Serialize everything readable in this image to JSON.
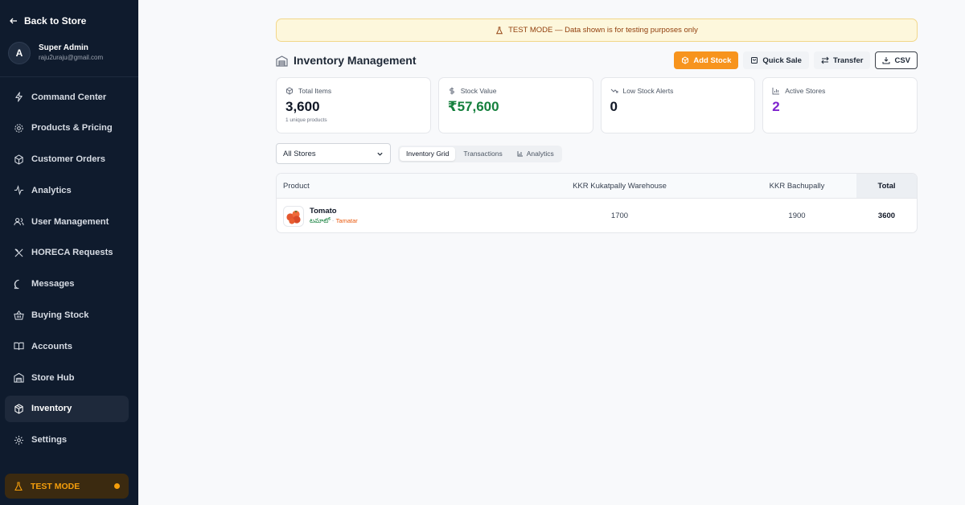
{
  "sidebar": {
    "back_label": "Back to Store",
    "user": {
      "initial": "A",
      "name": "Super Admin",
      "email": "raju2uraju@gmail.com"
    },
    "items": [
      {
        "label": "Command Center",
        "icon": "lightning-icon"
      },
      {
        "label": "Products & Pricing",
        "icon": "gear-icon"
      },
      {
        "label": "Customer Orders",
        "icon": "box-icon"
      },
      {
        "label": "Analytics",
        "icon": "pulse-icon"
      },
      {
        "label": "User Management",
        "icon": "users-icon"
      },
      {
        "label": "HORECA Requests",
        "icon": "utensils-icon"
      },
      {
        "label": "Messages",
        "icon": "message-icon"
      },
      {
        "label": "Buying Stock",
        "icon": "basket-icon"
      },
      {
        "label": "Accounts",
        "icon": "book-icon"
      },
      {
        "label": "Store Hub",
        "icon": "warehouse-icon"
      },
      {
        "label": "Inventory",
        "icon": "package-icon",
        "active": true
      },
      {
        "label": "Settings",
        "icon": "cog-icon"
      }
    ],
    "test_mode_label": "TEST MODE"
  },
  "banner": {
    "text": "TEST MODE — Data shown is for testing purposes only"
  },
  "header": {
    "title": "Inventory Management",
    "buttons": {
      "add_stock": "Add Stock",
      "quick_sale": "Quick Sale",
      "transfer": "Transfer",
      "csv": "CSV"
    }
  },
  "stats": [
    {
      "label": "Total Items",
      "value": "3,600",
      "sub": "1 unique products",
      "icon": "cube-icon"
    },
    {
      "label": "Stock Value",
      "value": "₹57,600",
      "icon": "dollar-icon"
    },
    {
      "label": "Low Stock Alerts",
      "value": "0",
      "icon": "trending-down-icon"
    },
    {
      "label": "Active Stores",
      "value": "2",
      "icon": "bar-chart-icon"
    }
  ],
  "filters": {
    "store_select": "All Stores",
    "tabs": [
      "Inventory Grid",
      "Transactions",
      "Analytics"
    ]
  },
  "table": {
    "headers": {
      "product": "Product",
      "w1": "KKR Kukatpally Warehouse",
      "w2": "KKR Bachupally",
      "total": "Total"
    },
    "rows": [
      {
        "name": "Tomato",
        "local": "టమాటో",
        "sep": "·",
        "alias": "Tamatar",
        "w1": "1700",
        "w2": "1900",
        "total": "3600"
      }
    ]
  },
  "colors": {
    "accent": "#f7941d",
    "sidebar": "#0f1b2d",
    "value_green": "#15803d",
    "value_purple": "#7e22ce"
  }
}
